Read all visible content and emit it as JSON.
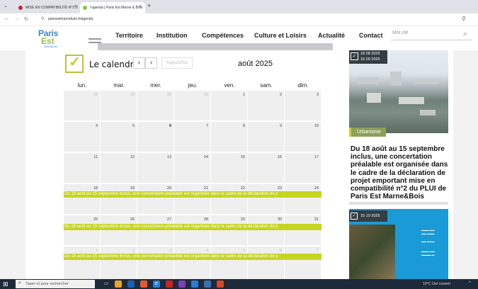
{
  "browser": {
    "tabs": [
      {
        "title": "MISE EN COMPATIBILITÉ N°2 D",
        "favicon_color": "#c0282e"
      },
      {
        "title": "l'agenda | Paris Est Marne & Bois",
        "favicon_color": "#8cc63f"
      }
    ],
    "url": "parisestmarnebois.fr/agenda",
    "icons": {
      "back": "back-arrow-icon",
      "forward": "forward-arrow-icon",
      "reload": "reload-icon",
      "new_tab": "plus-icon",
      "close": "close-icon"
    }
  },
  "site": {
    "logo": {
      "line1": "Paris",
      "line2": "Est",
      "line3": "Marne&Bois"
    },
    "nav": [
      "Territoire",
      "Institution",
      "Compétences",
      "Culture et Loisirs",
      "Actualité",
      "Contact"
    ],
    "search_placeholder": "Mot clé",
    "colors": {
      "accent": "#c6d520",
      "brand_blue": "#3d86c6",
      "brand_green": "#8cc63f"
    }
  },
  "calendar": {
    "title": "Le calendrier",
    "today_label": "Aujourd'hui",
    "month_label": "août 2025",
    "weekdays": [
      "lun.",
      "mar.",
      "mer.",
      "jeu.",
      "ven.",
      "sam.",
      "dim."
    ],
    "weeks": [
      [
        "28",
        "29",
        "30",
        "31",
        "1",
        "2",
        "3"
      ],
      [
        "4",
        "5",
        "6",
        "7",
        "8",
        "9",
        "10"
      ],
      [
        "11",
        "12",
        "13",
        "14",
        "15",
        "16",
        "17"
      ],
      [
        "18",
        "19",
        "20",
        "21",
        "22",
        "23",
        "24"
      ],
      [
        "25",
        "26",
        "27",
        "28",
        "29",
        "30",
        "31"
      ],
      [
        "1",
        "2",
        "3",
        "4",
        "5",
        "6",
        "7"
      ]
    ],
    "event_text": "Du 18 août au 15 septembre inclus, une concertation préalable est organisée dans le cadre de la déclaration de p"
  },
  "sidebar": {
    "card1": {
      "date_start": "18 08 2025",
      "date_end": "15 09 2025",
      "tag": "Urbanisme",
      "title": "Du 18 août au 15 septembre inclus, une concertation préalable est organisée dans le cadre de la déclaration de projet emportant mise en compatibilité n°2 du PLUI de Paris Est Marne&Bois"
    },
    "card2": {
      "date": "15 10 2025"
    }
  },
  "taskbar": {
    "search_placeholder": "Taper ici pour rechercher",
    "weather": "19°C Ciel couvert"
  }
}
